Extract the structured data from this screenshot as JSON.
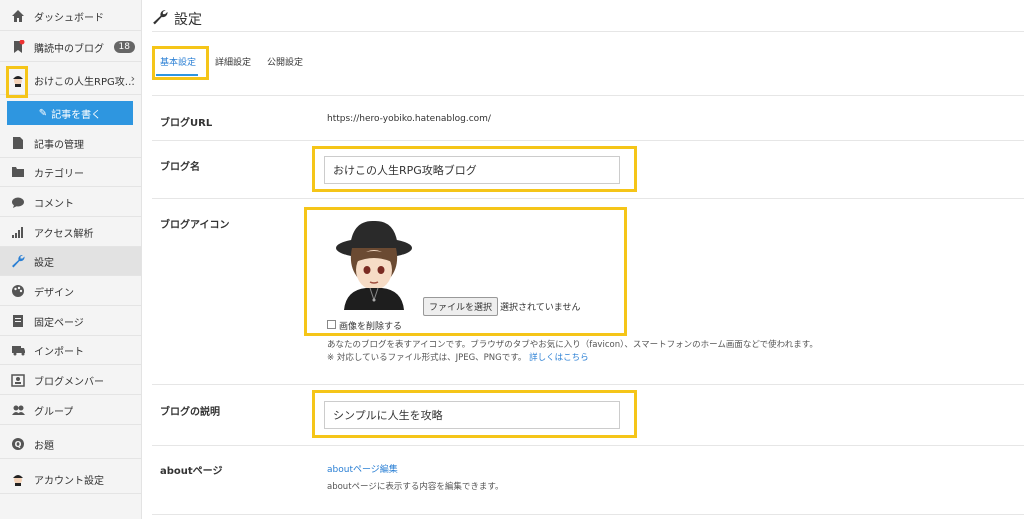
{
  "sidebar": {
    "items": [
      {
        "label": "ダッシュボード"
      },
      {
        "label": "購読中のブログ",
        "badge": "18"
      },
      {
        "label": "おけこの人生RPG攻…"
      },
      {
        "label": "記事の管理"
      },
      {
        "label": "カテゴリー"
      },
      {
        "label": "コメント"
      },
      {
        "label": "アクセス解析"
      },
      {
        "label": "設定"
      },
      {
        "label": "デザイン"
      },
      {
        "label": "固定ページ"
      },
      {
        "label": "インポート"
      },
      {
        "label": "ブログメンバー"
      },
      {
        "label": "グループ"
      },
      {
        "label": "お題"
      },
      {
        "label": "アカウント設定"
      }
    ],
    "write_button": "記事を書く"
  },
  "header": {
    "title": "設定"
  },
  "tabs": [
    {
      "label": "基本設定"
    },
    {
      "label": "詳細設定"
    },
    {
      "label": "公開設定"
    }
  ],
  "fields": {
    "url": {
      "label": "ブログURL",
      "value": "https://hero-yobiko.hatenablog.com/"
    },
    "name": {
      "label": "ブログ名",
      "value": "おけこの人生RPG攻略ブログ"
    },
    "icon": {
      "label": "ブログアイコン",
      "file_button": "ファイルを選択",
      "file_status": "選択されていません",
      "delete_label": "画像を削除する",
      "help1": "あなたのブログを表すアイコンです。ブラウザのタブやお気に入り（favicon）、スマートフォンのホーム画面などで使われます。",
      "help2": "※ 対応しているファイル形式は、JPEG、PNGです。",
      "help_link": "詳しくはこちら"
    },
    "description": {
      "label": "ブログの説明",
      "value": "シンプルに人生を攻略"
    },
    "about": {
      "label": "aboutページ",
      "link": "aboutページ編集",
      "help": "aboutページに表示する内容を編集できます。"
    }
  },
  "colors": {
    "accent": "#2e96e0",
    "highlight": "#f5c518"
  }
}
